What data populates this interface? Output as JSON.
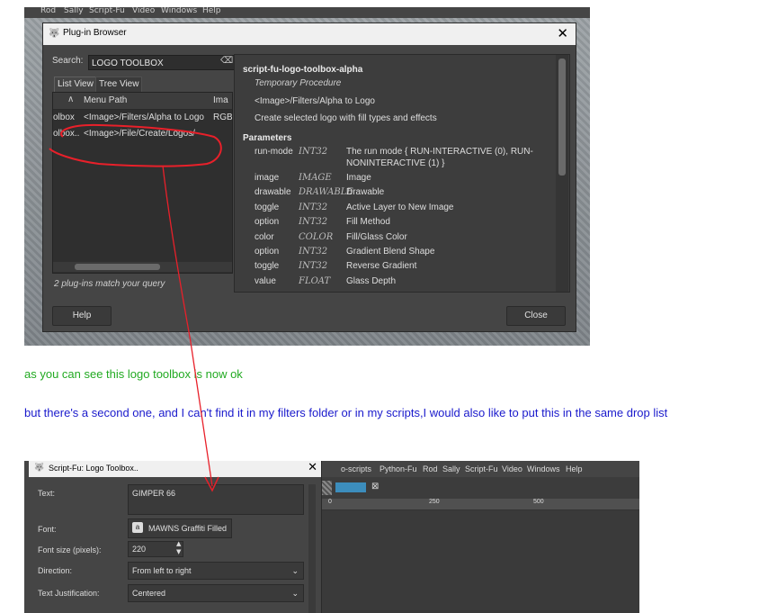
{
  "top_screenshot": {
    "menubar_items": [
      "Rod",
      "Sally",
      "Script-Fu",
      "Video",
      "Windows",
      "Help"
    ],
    "dialog": {
      "title": "Plug-in Browser",
      "search_label": "Search:",
      "search_value": "LOGO TOOLBOX",
      "tabs": [
        {
          "label": "List View",
          "active": true
        },
        {
          "label": "Tree View",
          "active": false
        }
      ],
      "columns": [
        "Menu Path",
        "Ima"
      ],
      "rows": [
        {
          "name": "olbox",
          "path": "<Image>/Filters/Alpha to Logo",
          "type": "RGB"
        },
        {
          "name": "olbox..",
          "path": "<Image>/File/Create/Logos/",
          "type": ""
        }
      ],
      "match_text": "2 plug-ins match your query",
      "details": {
        "name": "script-fu-logo-toolbox-alpha",
        "kind": "Temporary Procedure",
        "menu_path": "<Image>/Filters/Alpha to Logo",
        "description": "Create selected logo with fill types and effects",
        "params_heading": "Parameters",
        "params": [
          {
            "name": "run-mode",
            "type": "INT32",
            "desc": "The run mode { RUN-INTERACTIVE (0), RUN-",
            "desc2": "NONINTERACTIVE (1) }"
          },
          {
            "name": "image",
            "type": "IMAGE",
            "desc": "Image"
          },
          {
            "name": "drawable",
            "type": "DRAWABLE",
            "desc": "Drawable"
          },
          {
            "name": "toggle",
            "type": "INT32",
            "desc": "Active Layer to New Image"
          },
          {
            "name": "option",
            "type": "INT32",
            "desc": "Fill Method"
          },
          {
            "name": "color",
            "type": "COLOR",
            "desc": "Fill/Glass Color"
          },
          {
            "name": "option",
            "type": "INT32",
            "desc": "Gradient Blend Shape"
          },
          {
            "name": "toggle",
            "type": "INT32",
            "desc": "Reverse Gradient"
          },
          {
            "name": "value",
            "type": "FLOAT",
            "desc": "Glass Depth"
          }
        ]
      },
      "help_label": "Help",
      "close_label": "Close"
    }
  },
  "note_green": "as you can see this logo toolbox is now ok",
  "note_blue": "but there's a second one, and I can't find it in my filters folder or in my scripts,I would also like to put this in the same drop list",
  "bottom_screenshot": {
    "dialog_title": "Script-Fu: Logo Toolbox..",
    "fields": [
      {
        "label": "Text:",
        "value": "GIMPER 66"
      },
      {
        "label": "Font:",
        "value": "MAWNS Graffiti Filled"
      },
      {
        "label": "Font size (pixels):",
        "value": "220"
      },
      {
        "label": "Direction:",
        "value": "From left to right"
      },
      {
        "label": "Text Justification:",
        "value": "Centered"
      }
    ],
    "menubar_items": [
      "o-scripts",
      "Python-Fu",
      "Rod",
      "Sally",
      "Script-Fu",
      "Video",
      "Windows",
      "Help"
    ],
    "ruler_ticks": [
      "0",
      "250",
      "500"
    ]
  },
  "colors": {
    "annotation": "#e8202a",
    "note_green": "#22aa22",
    "note_blue": "#1a1acc",
    "dialog_bg": "#454545"
  }
}
